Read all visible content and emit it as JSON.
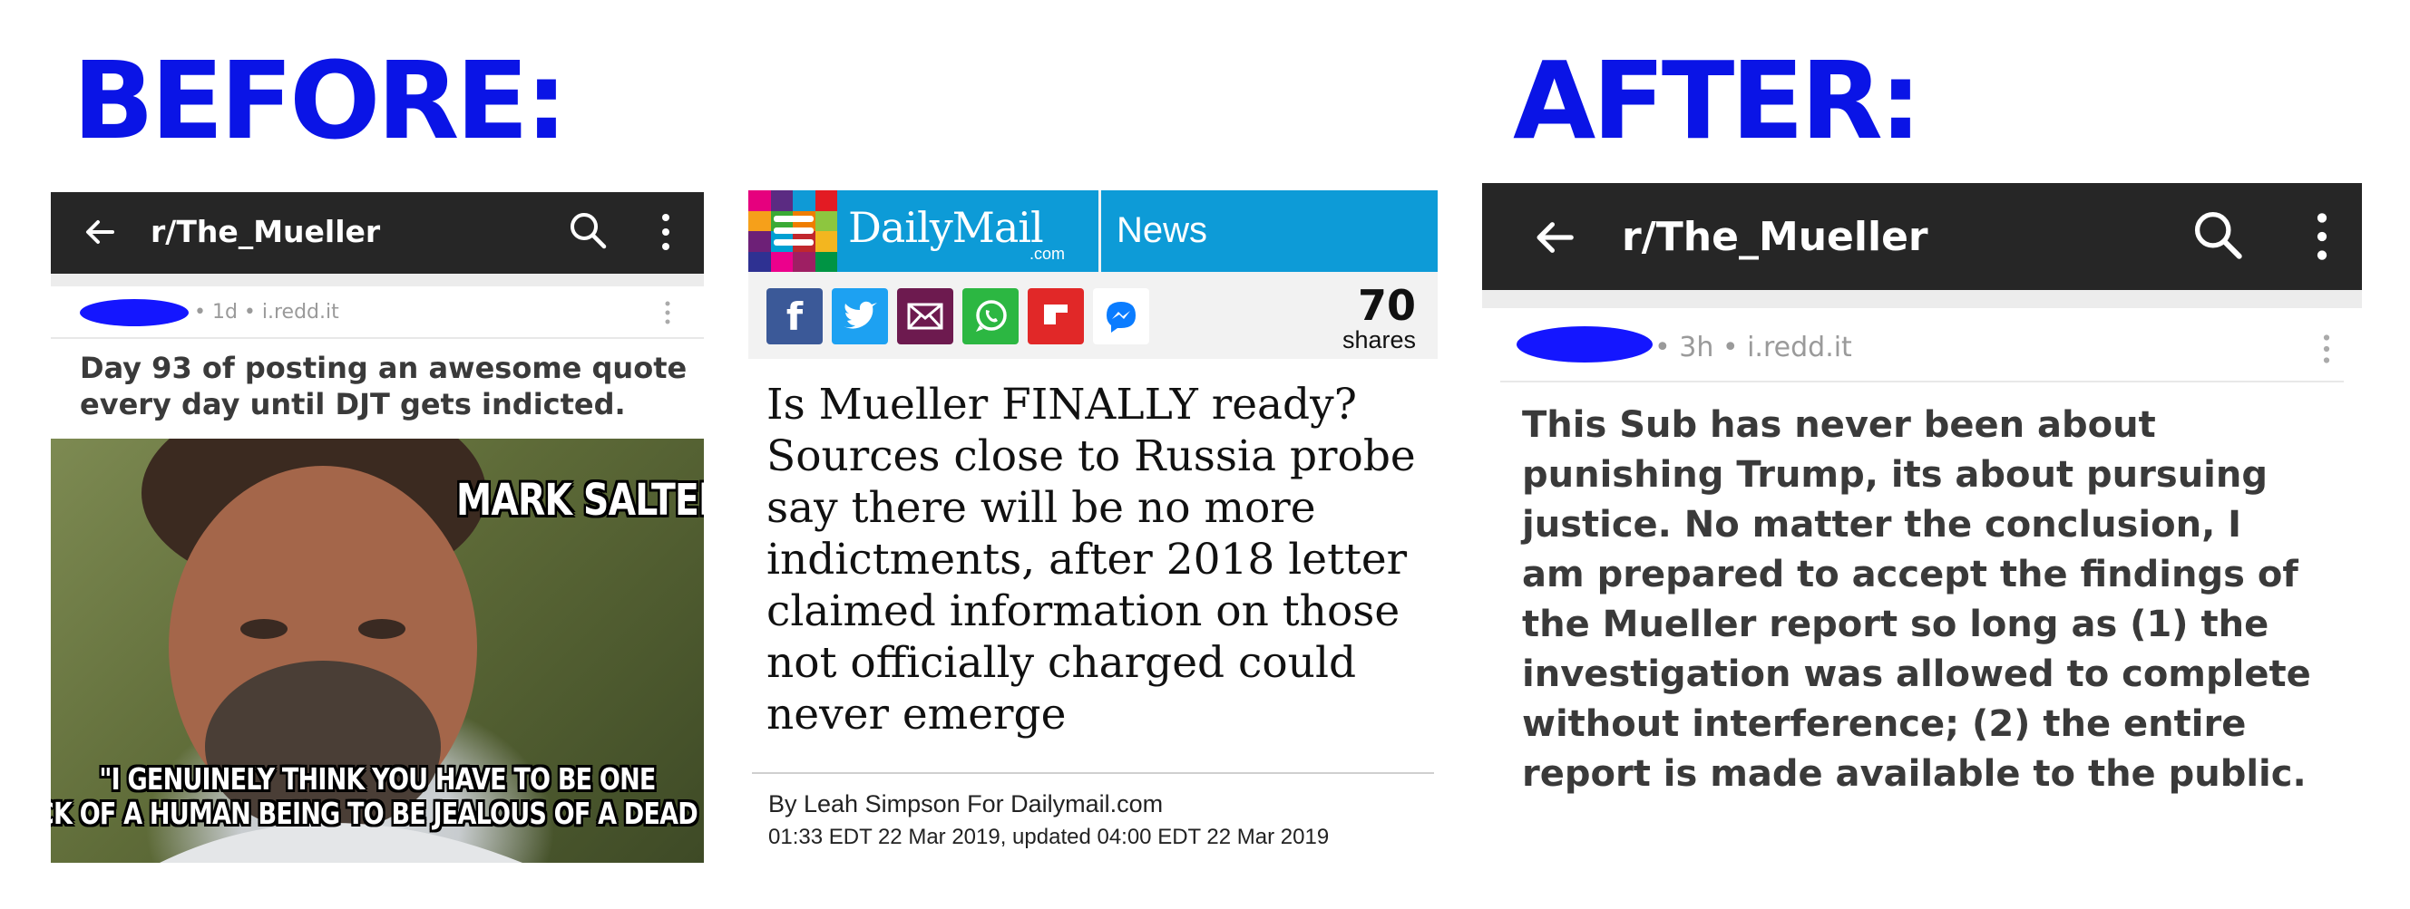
{
  "labels": {
    "before": "BEFORE:",
    "after": "AFTER:"
  },
  "before_post": {
    "subreddit": "r/The_Mueller",
    "meta": "• 1d • i.redd.it",
    "title_lines": [
      "Day 93 of posting an awesome quote",
      "every day until DJT gets indicted."
    ],
    "meme": {
      "name_caption": "MARK SALTER",
      "quote_lines": [
        "\"I GENUINELY THINK YOU HAVE TO BE ONE",
        "WRECK OF A HUMAN BEING TO BE JEALOUS OF A DEAD MAN.\""
      ]
    }
  },
  "dailymail": {
    "logo": "DailyMail",
    "logo_sub": ".com",
    "section": "News",
    "share_count": "70",
    "share_label": "shares",
    "share_icons": [
      "facebook-icon",
      "twitter-icon",
      "email-icon",
      "whatsapp-icon",
      "flipboard-icon",
      "messenger-icon"
    ],
    "headline_lines": [
      "Is Mueller FINALLY ready?",
      "Sources close to Russia probe",
      "say there will be no more",
      "indictments, after 2018 letter",
      "claimed information on those",
      "not officially charged could",
      "never emerge"
    ],
    "byline": "By Leah Simpson For Dailymail.com",
    "timestamp": "01:33 EDT 22 Mar 2019, updated 04:00 EDT 22 Mar 2019"
  },
  "after_post": {
    "subreddit": "r/The_Mueller",
    "meta": "• 3h • i.redd.it",
    "body_lines": [
      "This Sub has never been about",
      "punishing Trump, its about pursuing",
      "justice. No matter the conclusion, I",
      "am prepared to accept the findings of",
      "the Mueller report so long as (1) the",
      "investigation was allowed to complete",
      "without interference; (2) the entire",
      "report is made available to the public."
    ]
  },
  "colors": {
    "heading": "#0a14e6",
    "topbar": "#262626",
    "dm_blue": "#0d9bd7",
    "redact": "#1416ff"
  }
}
